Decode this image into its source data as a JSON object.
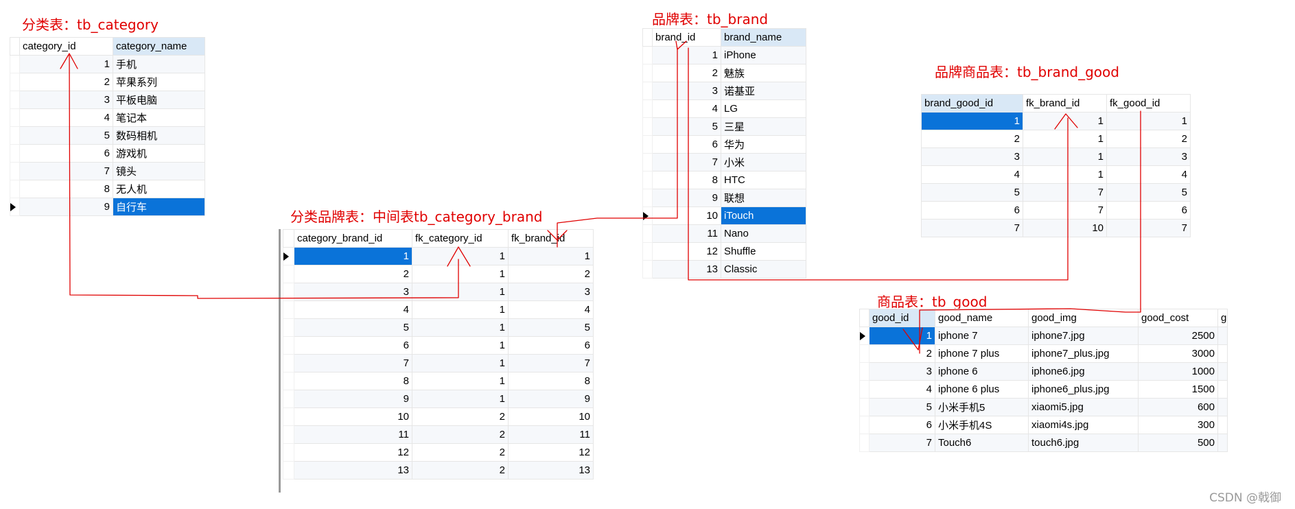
{
  "tb_category": {
    "title": "分类表：tb_category",
    "headers": [
      "category_id",
      "category_name"
    ],
    "rows": [
      [
        "1",
        "手机"
      ],
      [
        "2",
        "苹果系列"
      ],
      [
        "3",
        "平板电脑"
      ],
      [
        "4",
        "笔记本"
      ],
      [
        "5",
        "数码相机"
      ],
      [
        "6",
        "游戏机"
      ],
      [
        "7",
        "镜头"
      ],
      [
        "8",
        "无人机"
      ],
      [
        "9",
        "自行车"
      ]
    ]
  },
  "tb_category_brand": {
    "title": "分类品牌表：中间表tb_category_brand",
    "headers": [
      "category_brand_id",
      "fk_category_id",
      "fk_brand_id"
    ],
    "rows": [
      [
        "1",
        "1",
        "1"
      ],
      [
        "2",
        "1",
        "2"
      ],
      [
        "3",
        "1",
        "3"
      ],
      [
        "4",
        "1",
        "4"
      ],
      [
        "5",
        "1",
        "5"
      ],
      [
        "6",
        "1",
        "6"
      ],
      [
        "7",
        "1",
        "7"
      ],
      [
        "8",
        "1",
        "8"
      ],
      [
        "9",
        "1",
        "9"
      ],
      [
        "10",
        "2",
        "10"
      ],
      [
        "11",
        "2",
        "11"
      ],
      [
        "12",
        "2",
        "12"
      ],
      [
        "13",
        "2",
        "13"
      ]
    ]
  },
  "tb_brand": {
    "title": "品牌表：tb_brand",
    "headers": [
      "brand_id",
      "brand_name"
    ],
    "rows": [
      [
        "1",
        "iPhone"
      ],
      [
        "2",
        "魅族"
      ],
      [
        "3",
        "诺基亚"
      ],
      [
        "4",
        "LG"
      ],
      [
        "5",
        "三星"
      ],
      [
        "6",
        "华为"
      ],
      [
        "7",
        "小米"
      ],
      [
        "8",
        "HTC"
      ],
      [
        "9",
        "联想"
      ],
      [
        "10",
        "iTouch"
      ],
      [
        "11",
        "Nano"
      ],
      [
        "12",
        "Shuffle"
      ],
      [
        "13",
        "Classic"
      ]
    ]
  },
  "tb_brand_good": {
    "title": "品牌商品表：tb_brand_good",
    "headers": [
      "brand_good_id",
      "fk_brand_id",
      "fk_good_id"
    ],
    "rows": [
      [
        "1",
        "1",
        "1"
      ],
      [
        "2",
        "1",
        "2"
      ],
      [
        "3",
        "1",
        "3"
      ],
      [
        "4",
        "1",
        "4"
      ],
      [
        "5",
        "7",
        "5"
      ],
      [
        "6",
        "7",
        "6"
      ],
      [
        "7",
        "10",
        "7"
      ]
    ]
  },
  "tb_good": {
    "title": "商品表：tb_good",
    "headers": [
      "good_id",
      "good_name",
      "good_img",
      "good_cost",
      "gc"
    ],
    "rows": [
      [
        "1",
        "iphone 7",
        "iphone7.jpg",
        "2500"
      ],
      [
        "2",
        "iphone 7 plus",
        "iphone7_plus.jpg",
        "3000"
      ],
      [
        "3",
        "iphone 6",
        "iphone6.jpg",
        "1000"
      ],
      [
        "4",
        "iphone 6 plus",
        "iphone6_plus.jpg",
        "1500"
      ],
      [
        "5",
        "小米手机5",
        "xiaomi5.jpg",
        "600"
      ],
      [
        "6",
        "小米手机4S",
        "xiaomi4s.jpg",
        "300"
      ],
      [
        "7",
        "Touch6",
        "touch6.jpg",
        "500"
      ]
    ]
  },
  "watermark": "CSDN @戟御",
  "colors": {
    "annotation": "#e00000",
    "selection": "#0a73d9",
    "header_highlight": "#d9e8f6"
  }
}
